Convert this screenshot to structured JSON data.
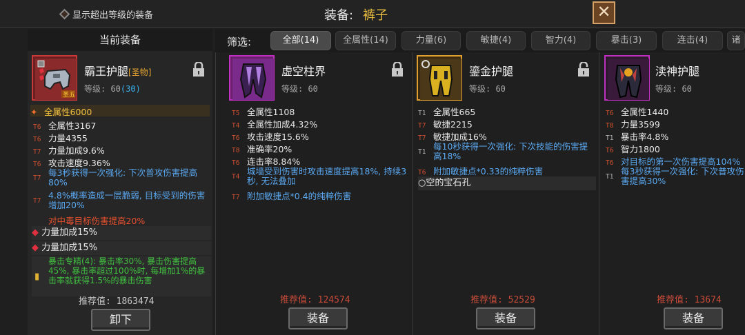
{
  "top": {
    "show_over_level": "显示超出等级的装备",
    "title_label": "装备:",
    "title_value": "裤子",
    "close_glyph": "✕"
  },
  "left_panel": {
    "header": "当前装备",
    "item_name": "霸王护腿",
    "item_tag": "[圣物]",
    "level_prefix": "等级: 60",
    "level_extra": "(30)",
    "badge": "圣五",
    "highlight_stat": "全属性6000",
    "stats": [
      {
        "tier": "T6",
        "text": "全属性3167"
      },
      {
        "tier": "T6",
        "text": "力量4355"
      },
      {
        "tier": "T7",
        "text": "力量加成9.6%"
      },
      {
        "tier": "T6",
        "text": "攻击速度9.36%"
      },
      {
        "tier": "T7",
        "text": "每3秒获得一次强化: 下次普攻伤害提高80%"
      },
      {
        "tier": "T7",
        "text": "4.8%概率造成一层脆弱, 目标受到的伤害增加20%"
      }
    ],
    "red_line": "对中毒目标伤害提高20%",
    "gems": [
      "力量加成15%",
      "力量加成15%"
    ],
    "set_text": "暴击专精(4): 暴击率30%, 暴击伤害提高45%, 暴击率超过100%时, 每增加1%的暴击率就获得1.5%的暴击伤害",
    "recommend": "推荐值: 1863474",
    "button": "卸下"
  },
  "filter": {
    "label": "筛选:",
    "tabs": [
      "全部(14)",
      "全属性(14)",
      "力量(6)",
      "敏捷(4)",
      "智力(4)",
      "暴击(3)",
      "连击(4)",
      "诸"
    ]
  },
  "cards": [
    {
      "name": "虚空柱界",
      "level": "等级: 60",
      "stats": [
        {
          "tier": "T5",
          "text": "全属性1108"
        },
        {
          "tier": "T4",
          "text": "全属性加成4.32%"
        },
        {
          "tier": "T6",
          "text": "攻击速度15.6%"
        },
        {
          "tier": "T8",
          "text": "准确率20%"
        },
        {
          "tier": "T6",
          "text": "连击率8.84%"
        },
        {
          "tier": "T4",
          "text": "城墙受到伤害时攻击速度提高18%, 持续3秒, 无法叠加"
        },
        {
          "tier": "T7",
          "text": "附加敏捷点*0.4的纯粹伤害"
        }
      ],
      "recommend": "推荐值: 124574",
      "button": "装备"
    },
    {
      "name": "鎏金护腿",
      "level": "等级: 60",
      "stats": [
        {
          "tier": "T1",
          "text": "全属性665"
        },
        {
          "tier": "T7",
          "text": "敏捷2215"
        },
        {
          "tier": "T7",
          "text": "敏捷加成16%"
        },
        {
          "tier": "T1",
          "text": "每10秒获得一次强化: 下次技能的伤害提高18%"
        },
        {
          "tier": "T6",
          "text": "附加敏捷点*0.33的纯粹伤害"
        }
      ],
      "gem": "空的宝石孔",
      "recommend": "推荐值: 52529",
      "button": "装备"
    },
    {
      "name": "渎神护腿",
      "level": "等级: 60",
      "stats": [
        {
          "tier": "T6",
          "text": "全属性1440"
        },
        {
          "tier": "T8",
          "text": "力量3599"
        },
        {
          "tier": "T1",
          "text": "暴击率4.8%"
        },
        {
          "tier": "T6",
          "text": "智力1800"
        },
        {
          "tier": "T6",
          "text": "对目标的第一次伤害提高104%"
        },
        {
          "tier": "T1",
          "text": "每3秒获得一次强化: 下次普攻伤害提高30%"
        }
      ],
      "recommend": "推荐值: 13674",
      "button": "装备"
    }
  ],
  "colors": {
    "accent_gold": "#f0c040",
    "relic_red_border": "#c83a3a",
    "purple_border": "#c030c0",
    "gold_border": "#e0a030",
    "stat_blue": "#5aa8f0",
    "recommend_red": "#c84b3a"
  }
}
